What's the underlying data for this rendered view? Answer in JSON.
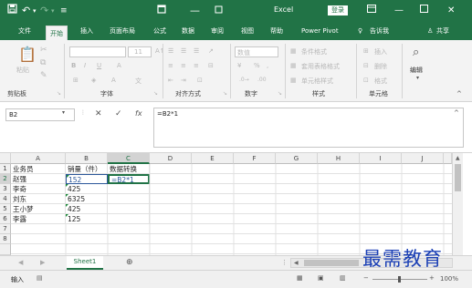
{
  "titlebar": {
    "save_icon": "save-icon",
    "undo_icon": "undo-icon",
    "redo_icon": "redo-icon",
    "customize_icon": "customize-icon",
    "title": "Excel",
    "login": "登录",
    "ribbon_display_icon": "ribbon-display-icon",
    "minimize_icon": "minimize-icon",
    "maximize_icon": "maximize-icon",
    "close_icon": "close-icon",
    "accent": "#217346"
  },
  "tabs": [
    {
      "label": "文件"
    },
    {
      "label": "开始"
    },
    {
      "label": "插入"
    },
    {
      "label": "页面布局"
    },
    {
      "label": "公式"
    },
    {
      "label": "数据"
    },
    {
      "label": "审阅"
    },
    {
      "label": "视图"
    },
    {
      "label": "帮助"
    },
    {
      "label": "Power Pivot"
    },
    {
      "label": "告诉我"
    },
    {
      "label": "共享"
    }
  ],
  "ribbon": {
    "clipboard": {
      "label": "剪贴板",
      "paste": "粘贴"
    },
    "font": {
      "label": "字体",
      "size": "11",
      "bold": "B",
      "italic": "I",
      "underline": "U"
    },
    "alignment": {
      "label": "对齐方式"
    },
    "number": {
      "label": "数字",
      "format": "数值",
      "percent": "%",
      "comma": ","
    },
    "styles": {
      "label": "样式",
      "conditional": "条件格式",
      "table": "套用表格格式",
      "cell": "单元格样式"
    },
    "cells": {
      "label": "单元格",
      "insert": "插入",
      "delete": "删除",
      "format": "格式"
    },
    "editing": {
      "label": "编辑"
    }
  },
  "formula_bar": {
    "name_box": "B2",
    "cancel_icon": "cancel-icon",
    "enter_icon": "enter-icon",
    "fx": "fx",
    "formula": "=B2*1"
  },
  "sheet": {
    "columns": [
      "A",
      "B",
      "C",
      "D",
      "E",
      "F",
      "G",
      "H",
      "I",
      "J"
    ],
    "rows": [
      "1",
      "2",
      "3",
      "4",
      "5",
      "6",
      "7",
      "8"
    ],
    "headers": [
      "业务员",
      "销量（件）",
      "数据转换"
    ],
    "data": [
      {
        "name": "赵强",
        "sales": "152",
        "conv": "=B2*1"
      },
      {
        "name": "李奇",
        "sales": "425",
        "conv": ""
      },
      {
        "name": "刘东",
        "sales": "6325",
        "conv": ""
      },
      {
        "name": "王小梦",
        "sales": "425",
        "conv": ""
      },
      {
        "name": "李露",
        "sales": "125",
        "conv": ""
      }
    ],
    "active_cell": "C2"
  },
  "sheet_tabs": {
    "active": "Sheet1",
    "add_icon": "add-sheet-icon"
  },
  "status": {
    "mode": "输入",
    "zoom": "100%"
  },
  "watermark": "最需教育"
}
